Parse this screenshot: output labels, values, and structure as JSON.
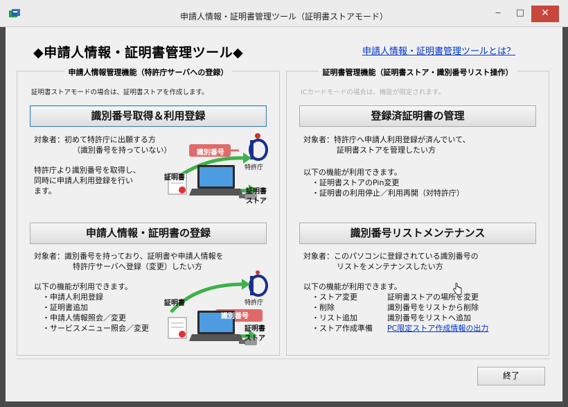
{
  "window": {
    "title": "申請人情報・証明書管理ツール（証明書ストアモード）",
    "minimize": "‒",
    "maximize": "□",
    "close": "✕"
  },
  "header": {
    "title": "◆申請人情報・証明書管理ツール◆",
    "help_link": "申請人情報・証明書管理ツールとは？"
  },
  "left_group": {
    "title": "申請人情報管理機能（特許庁サーバへの登録）",
    "note": "証明書ストアモードの場合は、証明書ストアを作成します。",
    "section1": {
      "button": "識別番号取得＆利用登録",
      "target_line1": "対象者：初めて特許庁に出願する方",
      "target_line2": "（識別番号を持っていない）",
      "desc_line1": "特許庁より識別番号を取得し、",
      "desc_line2": "同時に申請人利用登録を行い",
      "desc_line3": "ます。",
      "illu_id": "識別番号",
      "illu_cert": "証明書",
      "illu_jpo": "特許庁",
      "illu_store1": "証明書",
      "illu_store2": "ストア"
    },
    "section2": {
      "button": "申請人情報・証明書の登録",
      "target_line1": "対象者：識別番号を持っており、証明書や申請人情報を",
      "target_line2": "特許庁サーバへ登録（変更）したい方",
      "features_intro": "以下の機能が利用できます。",
      "features": [
        "・申請人利用登録",
        "・証明書追加",
        "・申請人情報照会／変更",
        "・サービスメニュー照会／変更"
      ],
      "illu_id": "識別番号",
      "illu_cert": "証明書",
      "illu_jpo": "特許庁",
      "illu_store1": "証明書",
      "illu_store2": "ストア"
    }
  },
  "right_group": {
    "title": "証明書管理機能（証明書ストア・識別番号リスト操作）",
    "note": "ICカードモードの場合は、機能が限定されます。",
    "section1": {
      "button": "登録済証明書の管理",
      "target_line1": "対象者：特許庁へ申請人利用登録が済んでいて、",
      "target_line2": "証明書ストアを管理したい方",
      "features_intro": "以下の機能が利用できます。",
      "features": [
        "・証明書ストアのPin変更",
        "・証明書の利用停止／利用再開（対特許庁）"
      ]
    },
    "section2": {
      "button": "識別番号リストメンテナンス",
      "target_line1": "対象者：このパソコンに登録されている識別番号の",
      "target_line2": "リストをメンテナンスしたい方",
      "features_intro": "以下の機能が利用できます。",
      "features": [
        {
          "name": "・ストア変更",
          "desc": "証明書ストアの場所を変更"
        },
        {
          "name": "・削除",
          "desc": "識別番号をリストから削除"
        },
        {
          "name": "・リスト追加",
          "desc": "識別番号をリストへ追加"
        },
        {
          "name": "・ストア作成準備",
          "desc": "PC限定ストア作成情報の出力"
        }
      ]
    }
  },
  "footer": {
    "end_button": "終了"
  },
  "colors": {
    "link": "#0033cc",
    "close_button": "#c7473d",
    "arrow_green": "#3fb04a",
    "id_badge": "#e06a6a"
  }
}
